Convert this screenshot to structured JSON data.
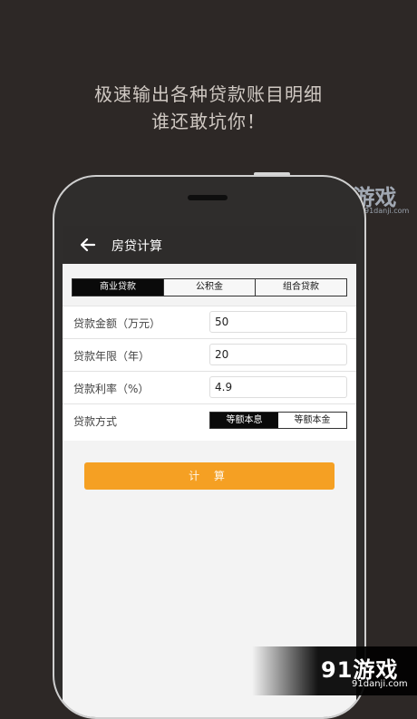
{
  "promo": {
    "line1": "极速输出各种贷款账目明细",
    "line2": "谁还敢坑你！"
  },
  "app": {
    "title": "房贷计算",
    "back_icon": "arrow-left-icon",
    "loan_tabs": [
      {
        "label": "商业贷款",
        "active": true
      },
      {
        "label": "公积金",
        "active": false
      },
      {
        "label": "组合贷款",
        "active": false
      }
    ],
    "form": {
      "amount_label": "贷款金额（万元）",
      "amount_value": "50",
      "term_label": "贷款年限（年）",
      "term_value": "20",
      "rate_label": "贷款利率（%）",
      "rate_value": "4.9",
      "method_label": "贷款方式",
      "method_options": [
        {
          "label": "等额本息",
          "active": true
        },
        {
          "label": "等额本金",
          "active": false
        }
      ]
    },
    "calc_button": "计 算"
  },
  "watermark": {
    "top_logo": "91游戏",
    "top_sub": "91danji.com",
    "bottom_logo": "91游戏",
    "bottom_sub": "91danji.com"
  }
}
